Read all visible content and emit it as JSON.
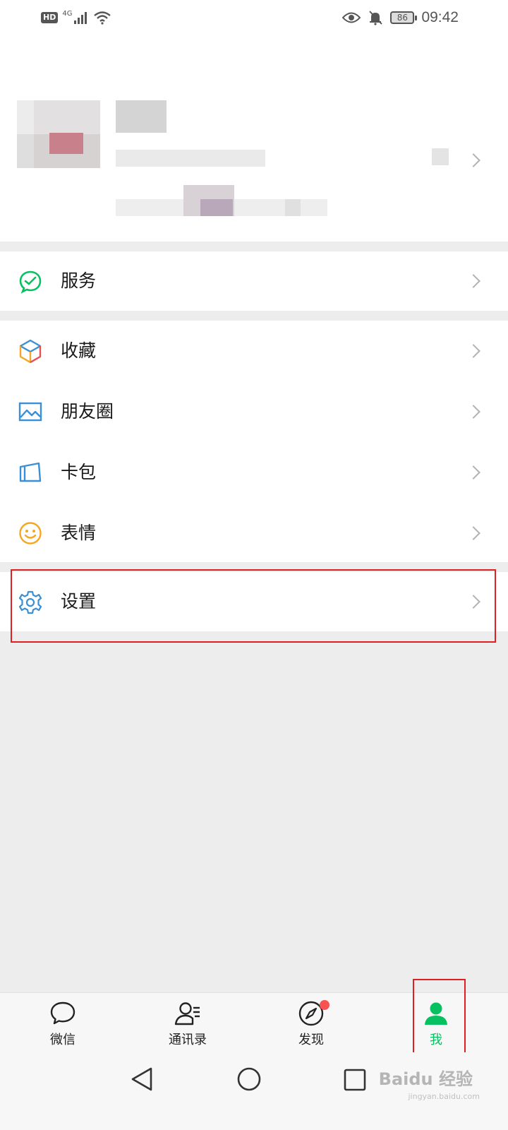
{
  "status_bar": {
    "hd": "HD",
    "network": "4G",
    "battery": "86",
    "time": "09:42"
  },
  "menu": {
    "service": "服务",
    "favorites": "收藏",
    "moments": "朋友圈",
    "cards": "卡包",
    "stickers": "表情",
    "settings": "设置"
  },
  "tabs": {
    "chats": "微信",
    "contacts": "通讯录",
    "discover": "发现",
    "me": "我"
  },
  "watermark": {
    "brand": "Baidu 经验",
    "url": "jingyan.baidu.com"
  },
  "colors": {
    "accent": "#07c160",
    "badge": "#fa5151",
    "highlight": "#e02020"
  }
}
